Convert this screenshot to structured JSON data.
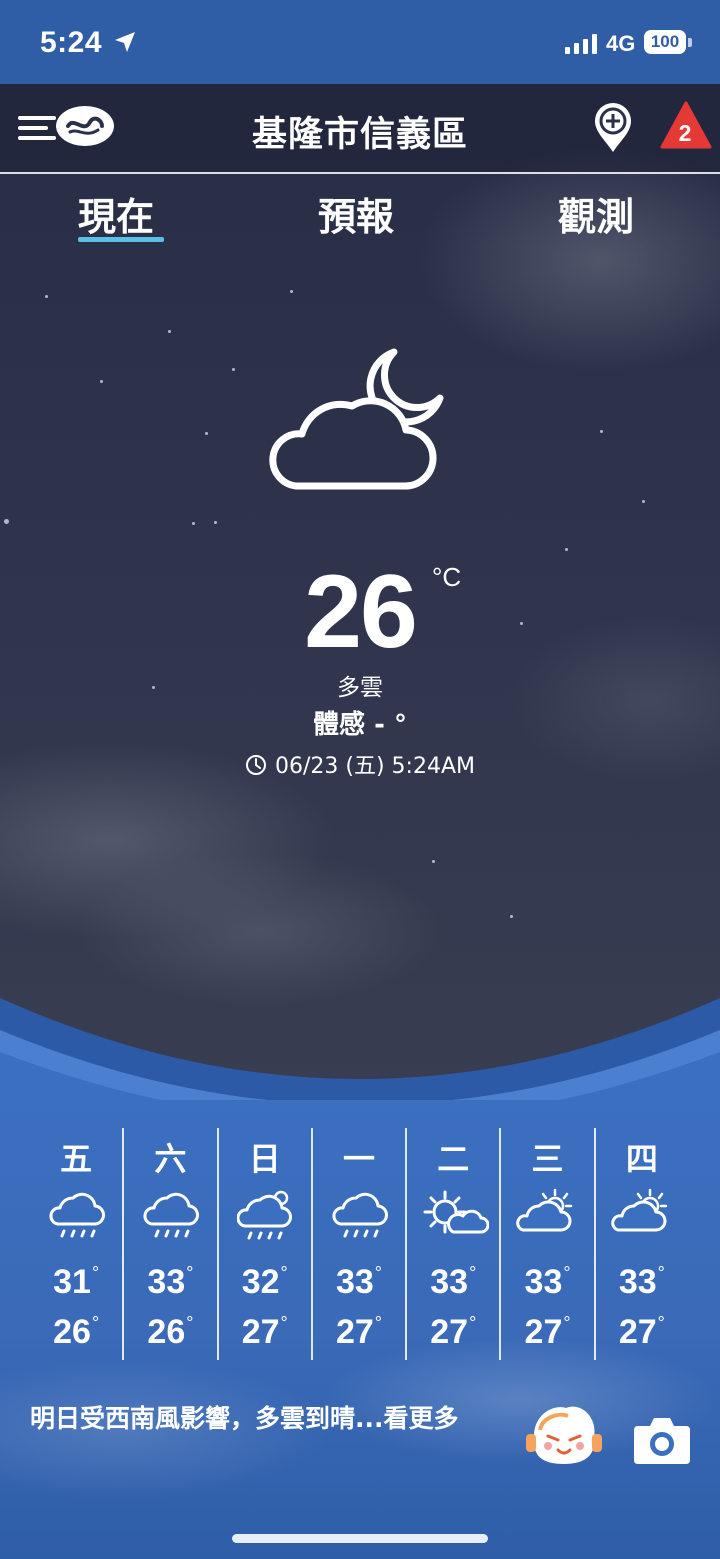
{
  "status_bar": {
    "time": "5:24",
    "network": "4G",
    "battery": "100",
    "icons": [
      "location-arrow-icon",
      "signal-icon",
      "battery-icon"
    ]
  },
  "header": {
    "title": "基隆市信義區",
    "alert_count": "2",
    "icons": [
      "menu-icon",
      "cwa-logo-icon",
      "add-location-icon",
      "warning-icon"
    ]
  },
  "tabs": [
    {
      "label": "現在",
      "active": true
    },
    {
      "label": "預報",
      "active": false
    },
    {
      "label": "觀測",
      "active": false
    }
  ],
  "current": {
    "icon": "partly-cloudy-night-icon",
    "temperature": "26",
    "unit": "°C",
    "condition": "多雲",
    "feels_like": "體感 - °",
    "updated": "06/23 (五) 5:24AM"
  },
  "forecast": [
    {
      "day": "五",
      "icon": "rain-icon",
      "high": "31",
      "low": "26"
    },
    {
      "day": "六",
      "icon": "rain-icon",
      "high": "33",
      "low": "26"
    },
    {
      "day": "日",
      "icon": "rain-partly-sunny-icon",
      "high": "32",
      "low": "27"
    },
    {
      "day": "一",
      "icon": "rain-icon",
      "high": "33",
      "low": "27"
    },
    {
      "day": "二",
      "icon": "sunny-partly-cloudy-icon",
      "high": "33",
      "low": "27"
    },
    {
      "day": "三",
      "icon": "partly-cloudy-icon",
      "high": "33",
      "low": "27"
    },
    {
      "day": "四",
      "icon": "partly-cloudy-icon",
      "high": "33",
      "low": "27"
    }
  ],
  "degree_symbol": "°",
  "summary": "明日受西南風影響，多雲到晴...看更多",
  "footer_icons": [
    "mascot-icon",
    "camera-icon"
  ],
  "colors": {
    "status_bar": "#2f5da6",
    "tab_underline": "#5bc0e8",
    "alert": "#e53935",
    "panel": "#3b6fc0"
  }
}
